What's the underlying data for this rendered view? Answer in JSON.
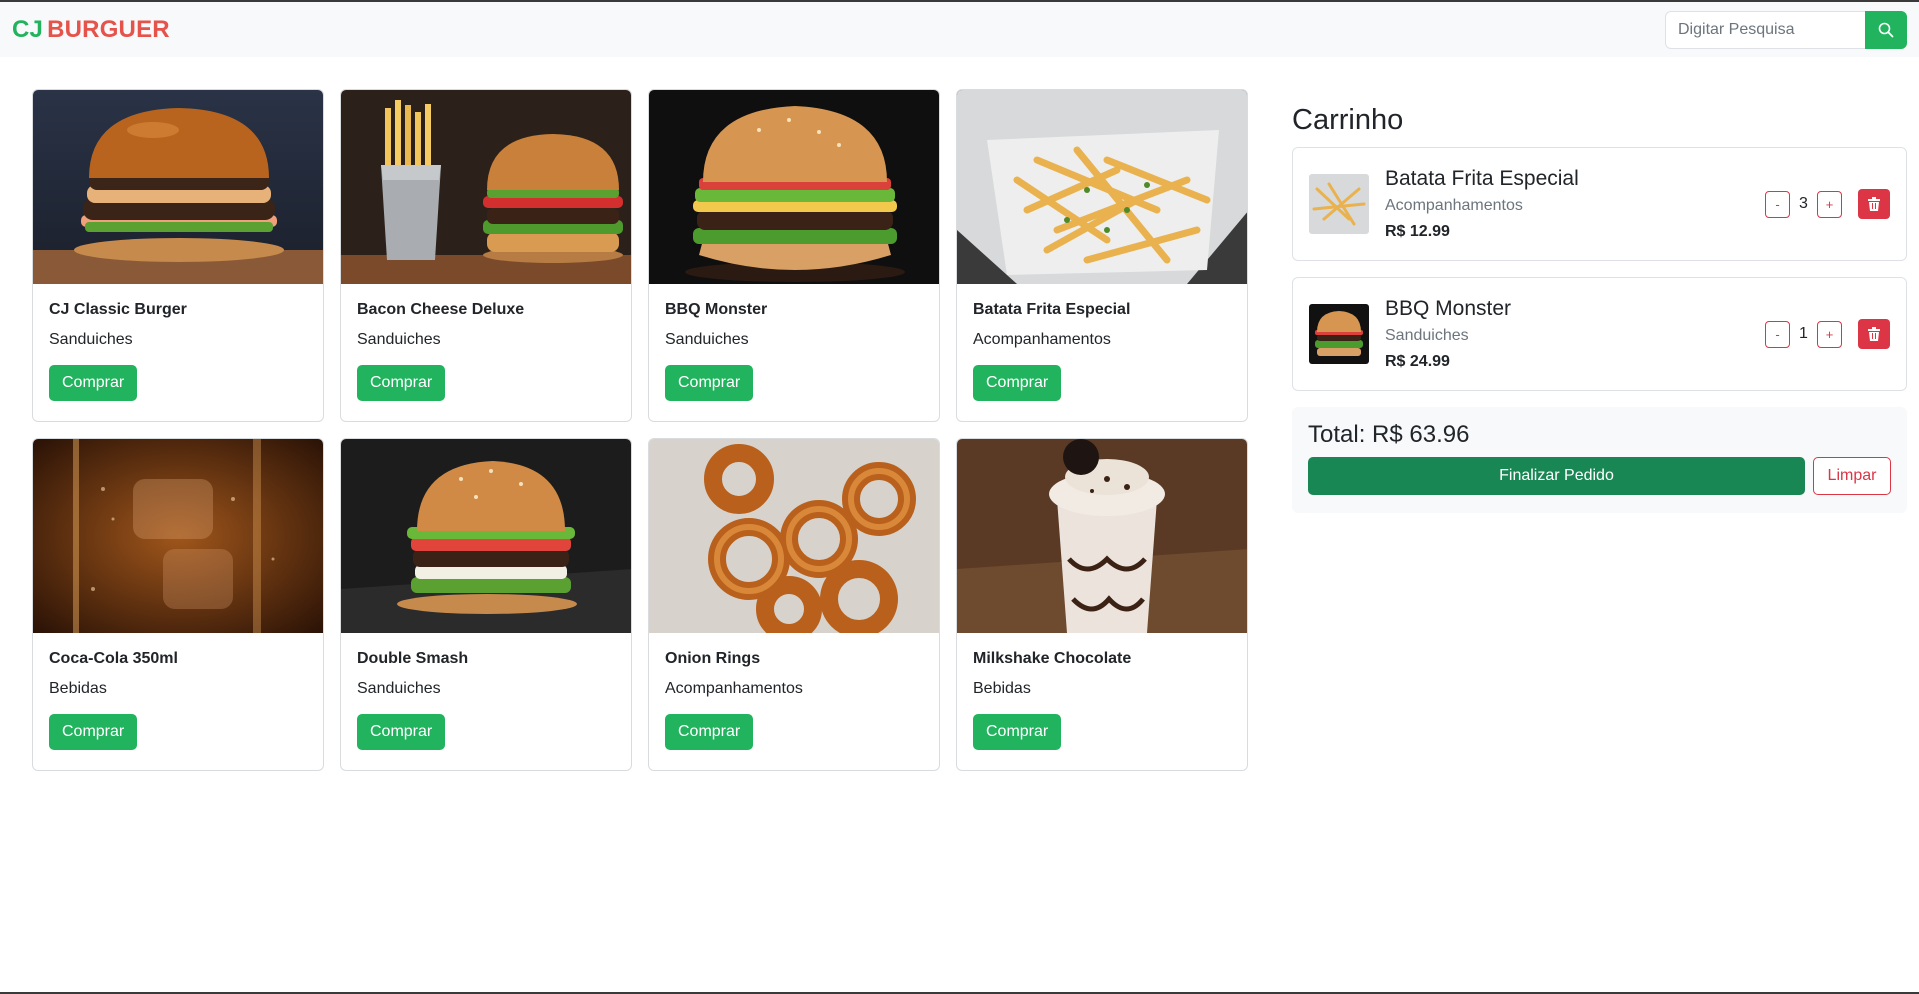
{
  "brand": {
    "part1": "CJ",
    "part2": "BURGUER"
  },
  "search": {
    "placeholder": "Digitar Pesquisa",
    "icon": "search-icon"
  },
  "products": [
    {
      "name": "CJ Classic Burger",
      "category": "Sanduiches",
      "button": "Comprar",
      "image": "burger"
    },
    {
      "name": "Bacon Cheese Deluxe",
      "category": "Sanduiches",
      "button": "Comprar",
      "image": "burger-fries"
    },
    {
      "name": "BBQ Monster",
      "category": "Sanduiches",
      "button": "Comprar",
      "image": "burger"
    },
    {
      "name": "Batata Frita Especial",
      "category": "Acompanhamentos",
      "button": "Comprar",
      "image": "fries"
    },
    {
      "name": "Coca-Cola 350ml",
      "category": "Bebidas",
      "button": "Comprar",
      "image": "cola"
    },
    {
      "name": "Double Smash",
      "category": "Sanduiches",
      "button": "Comprar",
      "image": "burger"
    },
    {
      "name": "Onion Rings",
      "category": "Acompanhamentos",
      "button": "Comprar",
      "image": "onion-rings"
    },
    {
      "name": "Milkshake Chocolate",
      "category": "Bebidas",
      "button": "Comprar",
      "image": "milkshake"
    }
  ],
  "cart": {
    "title": "Carrinho",
    "items": [
      {
        "name": "Batata Frita Especial",
        "category": "Acompanhamentos",
        "price": "R$ 12.99",
        "qty": "3",
        "minus": "-",
        "plus": "+"
      },
      {
        "name": "BBQ Monster",
        "category": "Sanduiches",
        "price": "R$ 24.99",
        "qty": "1",
        "minus": "-",
        "plus": "+"
      }
    ],
    "total": "Total: R$ 63.96",
    "finalize": "Finalizar Pedido",
    "clear": "Limpar"
  },
  "colors": {
    "primary": "#22b35e",
    "danger": "#dc3545",
    "brand_red": "#e5534b",
    "dark_green": "#198754"
  }
}
